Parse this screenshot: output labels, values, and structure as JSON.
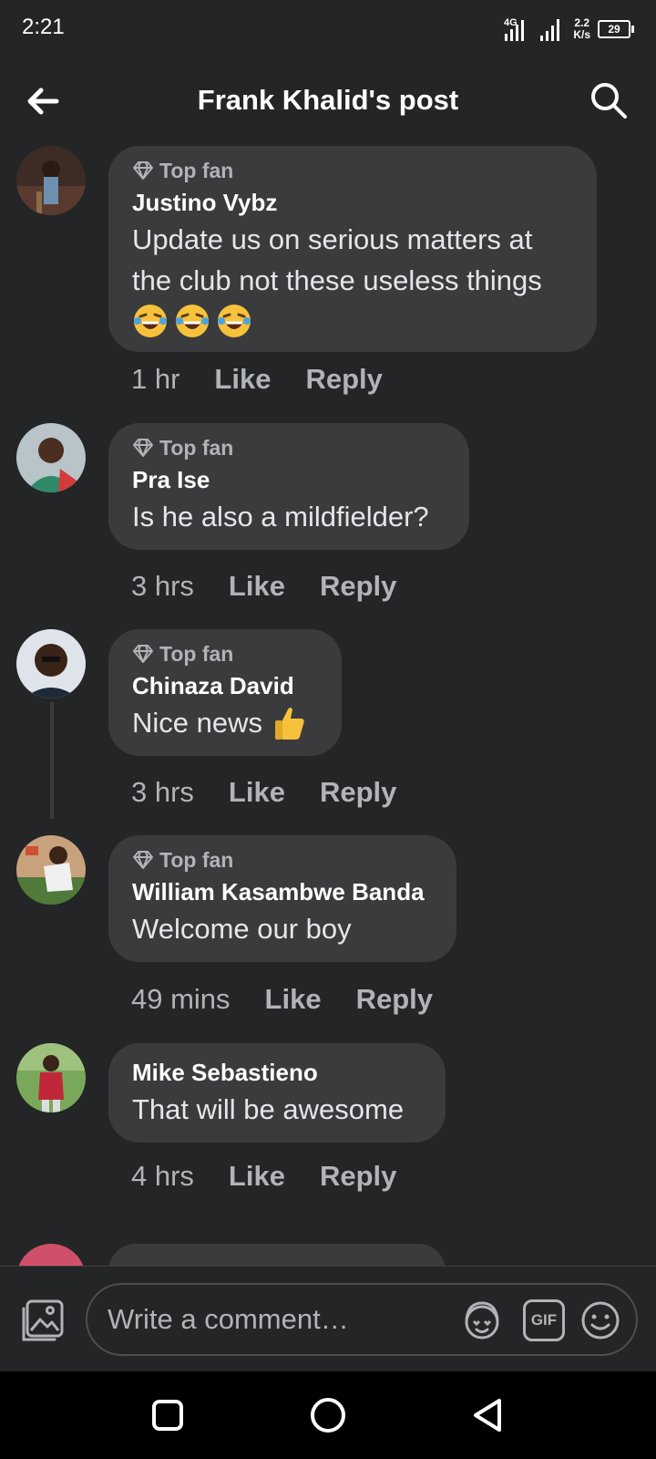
{
  "status_bar": {
    "time": "2:21",
    "network": "4G",
    "speed_value": "2.2",
    "speed_unit": "K/s",
    "battery": "29"
  },
  "header": {
    "title": "Frank Khalid's post",
    "back_icon": "back-arrow-icon",
    "search_icon": "search-icon"
  },
  "comments": [
    {
      "badge": "Top fan",
      "author": "Justino Vybz",
      "text": "Update us on serious matters at the club not these useless things",
      "emoji": "😂😂😂",
      "time": "1 hr",
      "like": "Like",
      "reply": "Reply"
    },
    {
      "badge": "Top fan",
      "author": "Pra Ise",
      "text": "Is he also a mildfielder?",
      "time": "3 hrs",
      "like": "Like",
      "reply": "Reply"
    },
    {
      "badge": "Top fan",
      "author": "Chinaza David",
      "text": "Nice news",
      "emoji": "👍",
      "time": "3 hrs",
      "like": "Like",
      "reply": "Reply"
    },
    {
      "badge": "Top fan",
      "author": "William Kasambwe Banda",
      "text": "Welcome our boy",
      "time": "49 mins",
      "like": "Like",
      "reply": "Reply"
    },
    {
      "author": "Mike Sebastieno",
      "text": "That will be awesome",
      "time": "4 hrs",
      "like": "Like",
      "reply": "Reply"
    }
  ],
  "composer": {
    "placeholder": "Write a comment…",
    "gif_label": "GIF"
  },
  "colors": {
    "background": "#242526",
    "bubble": "#3a3b3c",
    "secondary_text": "#b0b3b8",
    "primary_text": "#e4e6eb"
  }
}
